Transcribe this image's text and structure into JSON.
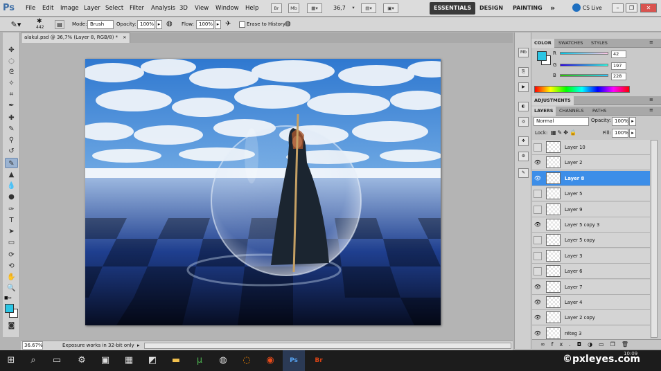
{
  "app": {
    "logo": "Ps"
  },
  "menu": [
    "File",
    "Edit",
    "Image",
    "Layer",
    "Select",
    "Filter",
    "Analysis",
    "3D",
    "View",
    "Window",
    "Help"
  ],
  "menubar_buttons": {
    "br": "Br",
    "mb": "Mb",
    "zoom": "36,7"
  },
  "workspaces": {
    "essentials": "ESSENTIALS",
    "design": "DESIGN",
    "painting": "PAINTING",
    "more": "»",
    "cslive": "CS Live"
  },
  "window_buttons": {
    "minimize": "–",
    "restore": "❐",
    "close": "✕"
  },
  "options": {
    "brush_size": "442",
    "mode_label": "Mode:",
    "mode_value": "Brush",
    "opacity_label": "Opacity:",
    "opacity_value": "100%",
    "flow_label": "Flow:",
    "flow_value": "100%",
    "erase_label": "Erase to History"
  },
  "document": {
    "tab_title": "alakul.psd @ 36,7% (Layer 8, RGB/8) *",
    "tab_close": "✕"
  },
  "status": {
    "zoom": "36.67%",
    "info": "Exposure works in 32-bit only"
  },
  "color_panel": {
    "tabs": [
      "COLOR",
      "SWATCHES",
      "STYLES"
    ],
    "r_label": "R",
    "g_label": "G",
    "b_label": "B",
    "r": 42,
    "g": 197,
    "b": 228,
    "fg_color": "#2ac5e4"
  },
  "adjustments_panel": {
    "tab": "ADJUSTMENTS"
  },
  "layers_panel": {
    "tabs": [
      "LAYERS",
      "CHANNELS",
      "PATHS"
    ],
    "blend_mode": "Normal",
    "opacity_label": "Opacity:",
    "opacity": "100%",
    "lock_label": "Lock:",
    "fill_label": "Fill:",
    "fill": "100%",
    "layers": [
      {
        "name": "Layer 10",
        "visible": false,
        "selected": false
      },
      {
        "name": "Layer 2",
        "visible": true,
        "selected": false
      },
      {
        "name": "Layer 8",
        "visible": true,
        "selected": true
      },
      {
        "name": "Layer 5",
        "visible": false,
        "selected": false
      },
      {
        "name": "Layer 9",
        "visible": false,
        "selected": false
      },
      {
        "name": "Layer 5 copy 3",
        "visible": true,
        "selected": false
      },
      {
        "name": "Layer 5 copy",
        "visible": false,
        "selected": false
      },
      {
        "name": "Layer 3",
        "visible": false,
        "selected": false
      },
      {
        "name": "Layer 6",
        "visible": false,
        "selected": false
      },
      {
        "name": "Layer 7",
        "visible": true,
        "selected": false
      },
      {
        "name": "Layer 4",
        "visible": true,
        "selected": false
      },
      {
        "name": "Layer 2 copy",
        "visible": true,
        "selected": false
      },
      {
        "name": "réteg 3",
        "visible": true,
        "selected": false
      }
    ],
    "footer_fx": "fx."
  },
  "taskbar": {
    "time": "10:09",
    "watermark": "©pxleyes.com"
  },
  "colors": {
    "accent": "#3d8ee8",
    "fg": "#2ac5e4",
    "workspace_active": "#3a3a3a"
  }
}
